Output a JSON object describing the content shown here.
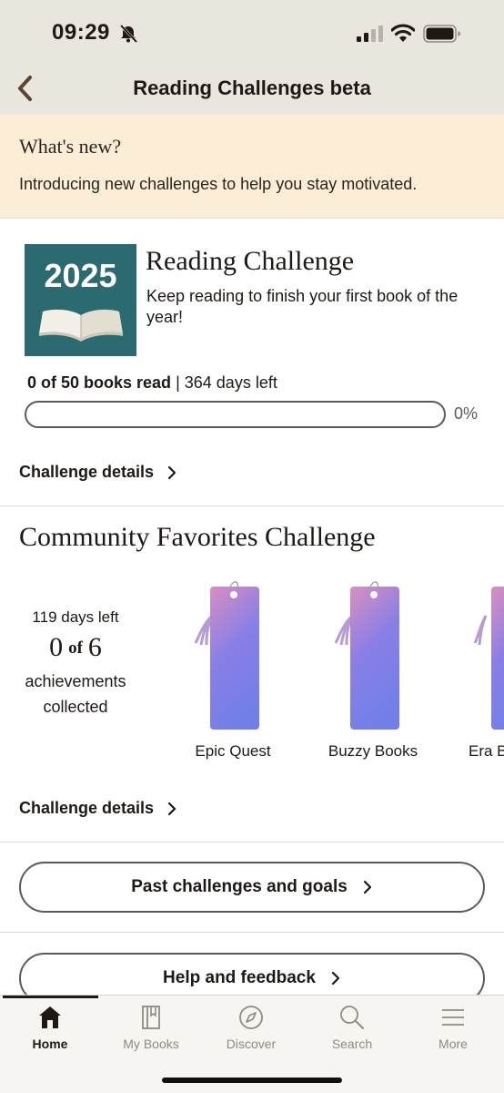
{
  "status_bar": {
    "time": "09:29"
  },
  "header": {
    "title": "Reading Challenges beta"
  },
  "whats_new": {
    "title": "What's new?",
    "text": "Introducing new challenges to help you stay motivated."
  },
  "reading_challenge": {
    "cover_year": "2025",
    "title": "Reading Challenge",
    "description": "Keep reading to finish your first book of the year!",
    "books_read_text": "0 of 50 books read",
    "days_left_text": "364 days left",
    "progress_fraction": 0,
    "progress_percent_label": "0%",
    "details_label": "Challenge details",
    "accent_color": "#2a6a70"
  },
  "community_challenge": {
    "title": "Community Favorites Challenge",
    "days_left": "119 days left",
    "collected": "0",
    "of_label": "of",
    "total": "6",
    "achievements_line1": "achievements",
    "achievements_line2": "collected",
    "bookmarks": [
      {
        "label": "Epic Quest"
      },
      {
        "label": "Buzzy Books"
      },
      {
        "label": "Era B"
      }
    ],
    "details_label": "Challenge details"
  },
  "buttons": {
    "past_challenges": "Past challenges and goals",
    "help_feedback": "Help and feedback"
  },
  "bottom_nav": {
    "items": [
      {
        "label": "Home",
        "icon": "home-icon",
        "active": true
      },
      {
        "label": "My Books",
        "icon": "my-books-icon",
        "active": false
      },
      {
        "label": "Discover",
        "icon": "compass-icon",
        "active": false
      },
      {
        "label": "Search",
        "icon": "search-icon",
        "active": false
      },
      {
        "label": "More",
        "icon": "menu-icon",
        "active": false
      }
    ]
  }
}
